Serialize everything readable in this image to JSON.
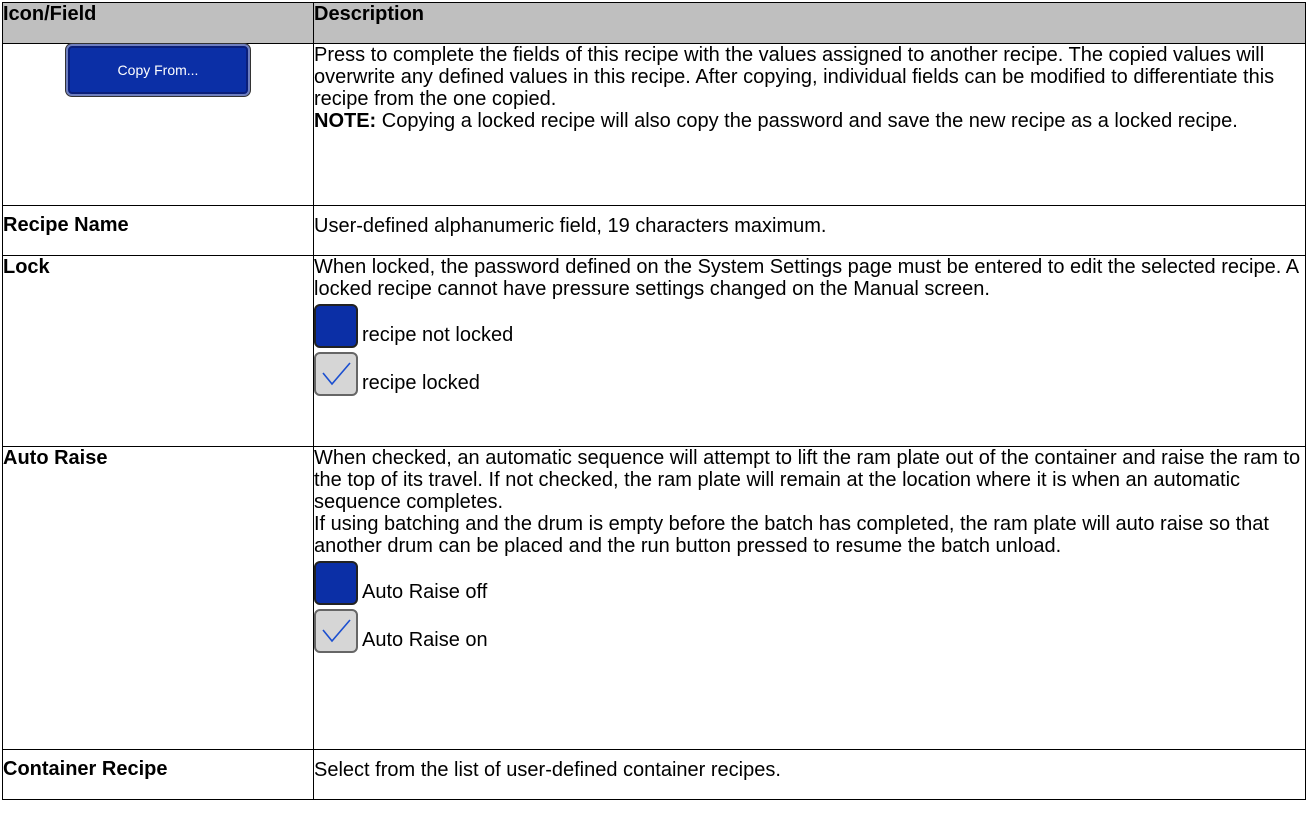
{
  "table": {
    "header": {
      "col1": "Icon/Field",
      "col2": "Description"
    },
    "rows": {
      "copy_from": {
        "button_label": "Copy From...",
        "desc_text": "Press to complete the fields of this recipe with the values assigned to another recipe. The copied values will overwrite any defined values in this recipe. After copying, individual fields can be modified to differentiate this recipe from the one copied.",
        "note_label": "NOTE:",
        "note_text": " Copying a locked recipe will also copy the password and save the new recipe as a locked recipe."
      },
      "recipe_name": {
        "field": "Recipe Name",
        "desc": "User-defined alphanumeric field, 19 characters maximum."
      },
      "lock": {
        "field": "Lock",
        "desc": "When locked, the password defined on the System Settings page must be entered to edit the selected recipe. A locked recipe cannot have pressure settings changed on the Manual screen.",
        "off_label": "recipe not locked",
        "on_label": "recipe locked"
      },
      "auto_raise": {
        "field": "Auto Raise",
        "desc1": "When checked, an automatic sequence will attempt to lift the ram plate out of the container and raise the ram to the top of its travel. If not checked, the ram plate will remain at the location where it is when an automatic sequence completes.",
        "desc2": "If using batching and the drum is empty before the batch has completed, the ram plate will auto raise so that another drum can be placed and the run button pressed to resume the batch unload.",
        "off_label": "Auto Raise off",
        "on_label": "Auto Raise on"
      },
      "container_recipe": {
        "field": "Container Recipe",
        "desc": "Select from the list of user-defined container recipes."
      }
    }
  },
  "colors": {
    "header_bg": "#bfbfbf",
    "button_blue": "#0b2fa6",
    "checkbox_checked_bg": "#d6d6d6",
    "checkmark": "#1b4fd0"
  },
  "icons": [
    "checkbox-unchecked-icon",
    "checkbox-checked-icon"
  ]
}
